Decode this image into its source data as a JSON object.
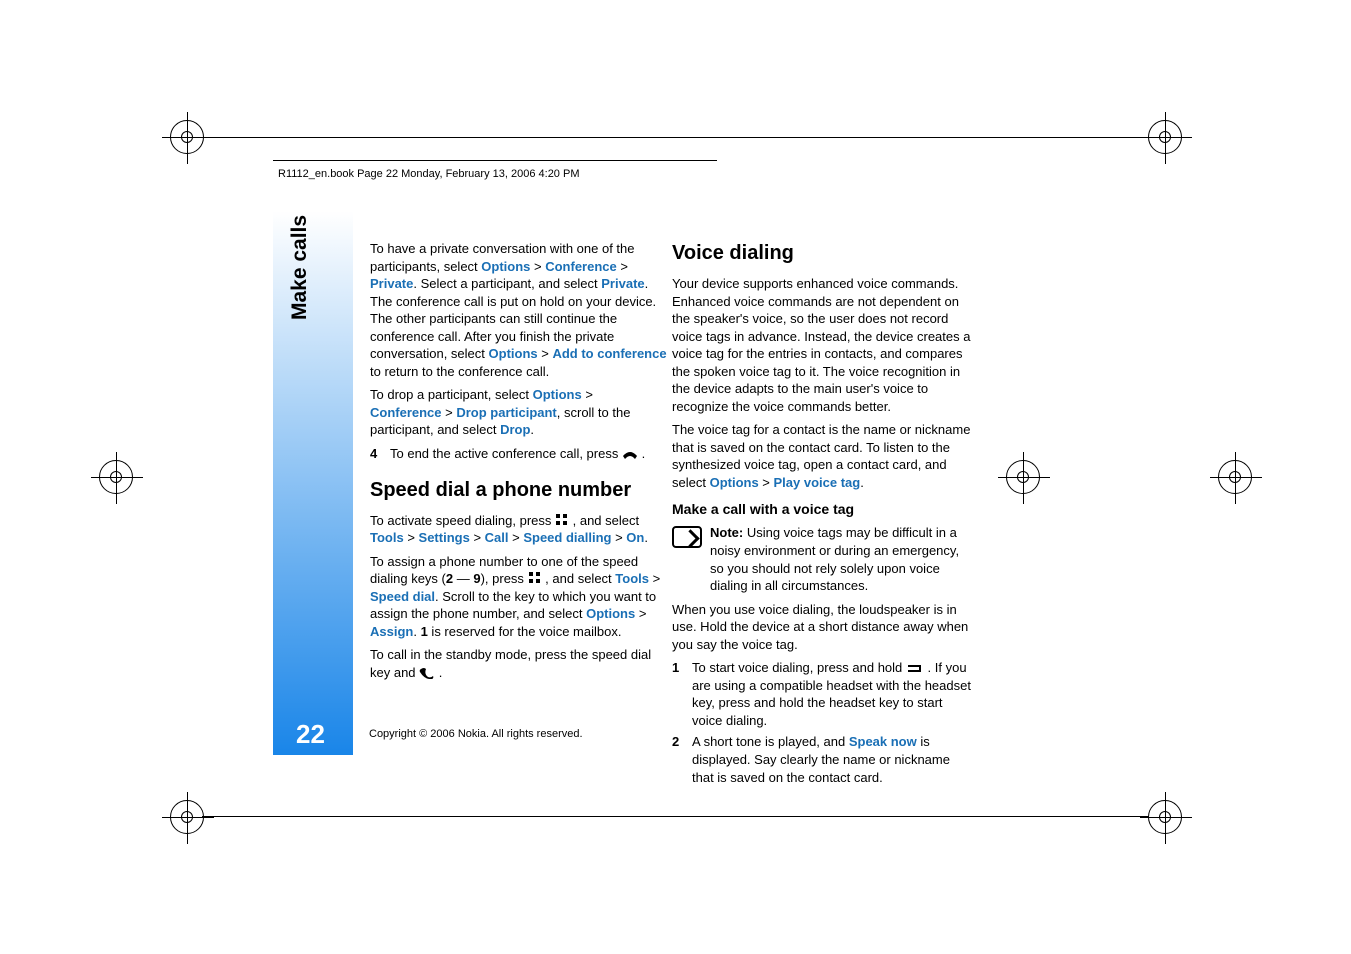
{
  "header": {
    "crop_line": "R1112_en.book  Page 22  Monday, February 13, 2006  4:20 PM"
  },
  "sidebar": {
    "tab": "Make calls",
    "page_number": "22"
  },
  "footer": {
    "copyright": "Copyright © 2006 Nokia. All rights reserved."
  },
  "left": {
    "p1_a": "To have a private conversation with one of the participants, select ",
    "opt": "Options",
    "gt": " > ",
    "conf": "Conference",
    "priv": "Private",
    "p1_b": ". Select a participant, and select ",
    "p1_c": ". The conference call is put on hold on your device. The other participants can still continue the conference call. After you finish the private conversation, select ",
    "add_conf": "Add to conference",
    "p1_d": " to return to the conference call.",
    "p2_a": "To drop a participant, select ",
    "drop_part": "Drop participant",
    "p2_b": ", scroll to the participant, and select ",
    "drop": "Drop",
    "p2_c": ".",
    "step4_n": "4",
    "step4_t_a": "To end the active conference call, press ",
    "step4_t_b": ".",
    "h2": "Speed dial a phone number",
    "p3_a": "To activate speed dialing, press ",
    "p3_b": ", and select ",
    "tools": "Tools",
    "settings": "Settings",
    "call": "Call",
    "speed_dialling": "Speed dialling",
    "on": "On",
    "p3_c": ".",
    "p4_a": "To assign a phone number to one of the speed dialing keys (",
    "key2": "2",
    "dash": " — ",
    "key9": "9",
    "p4_b": "), press ",
    "p4_c": ", and select ",
    "speed_dial": "Speed dial",
    "p4_d": ". Scroll to the key to which you want to assign the phone number, and select ",
    "assign": "Assign",
    "p4_e": ". ",
    "key1": "1",
    "p4_f": " is reserved for the voice mailbox.",
    "p5_a": "To call in the standby mode, press the speed dial key and ",
    "p5_b": "."
  },
  "right": {
    "h2": "Voice dialing",
    "p1": "Your device supports enhanced voice commands. Enhanced voice commands are not dependent on the speaker's voice, so the user does not record voice tags in advance. Instead, the device creates a voice tag for the entries in contacts, and compares the spoken voice tag to it. The voice recognition in the device adapts to the main user's voice to recognize the voice commands better.",
    "p2_a": "The voice tag for a contact is the name or nickname that is saved on the contact card. To listen to the synthesized voice tag, open a contact card, and select ",
    "opt": "Options",
    "gt": " > ",
    "play_vt": "Play voice tag",
    "p2_b": ".",
    "h3": "Make a call with a voice tag",
    "note_label": "Note:",
    "note_body": " Using voice tags may be difficult in a noisy environment or during an emergency, so you should not rely solely upon voice dialing in all circumstances.",
    "p3": "When you use voice dialing, the loudspeaker is in use. Hold the device at a short distance away when you say the voice tag.",
    "s1_n": "1",
    "s1_a": "To start voice dialing, press and hold ",
    "s1_b": ". If you are using a compatible headset with the headset key, press and hold the headset key to start voice dialing.",
    "s2_n": "2",
    "s2_a": "A short tone is played, and ",
    "speak_now": "Speak now",
    "s2_b": " is displayed. Say clearly the name or nickname that is saved on the contact card."
  }
}
